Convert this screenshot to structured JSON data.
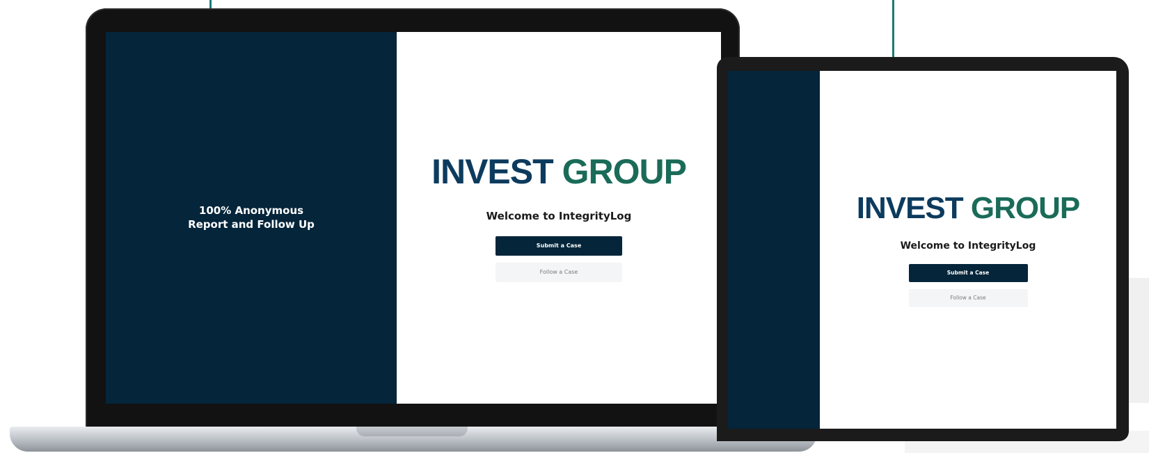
{
  "brand": {
    "word1": "INVEST",
    "word2": "GROUP",
    "primary_color": "#0d3b5e",
    "secondary_color": "#1a6b58"
  },
  "laptop": {
    "tagline_line1": "100% Anonymous",
    "tagline_line2": "Report and Follow Up",
    "welcome": "Welcome to IntegrityLog",
    "submit_label": "Submit a Case",
    "follow_label": "Follow a Case"
  },
  "tablet": {
    "welcome": "Welcome to IntegrityLog",
    "submit_label": "Submit a Case",
    "follow_label": "Follow a Case"
  }
}
